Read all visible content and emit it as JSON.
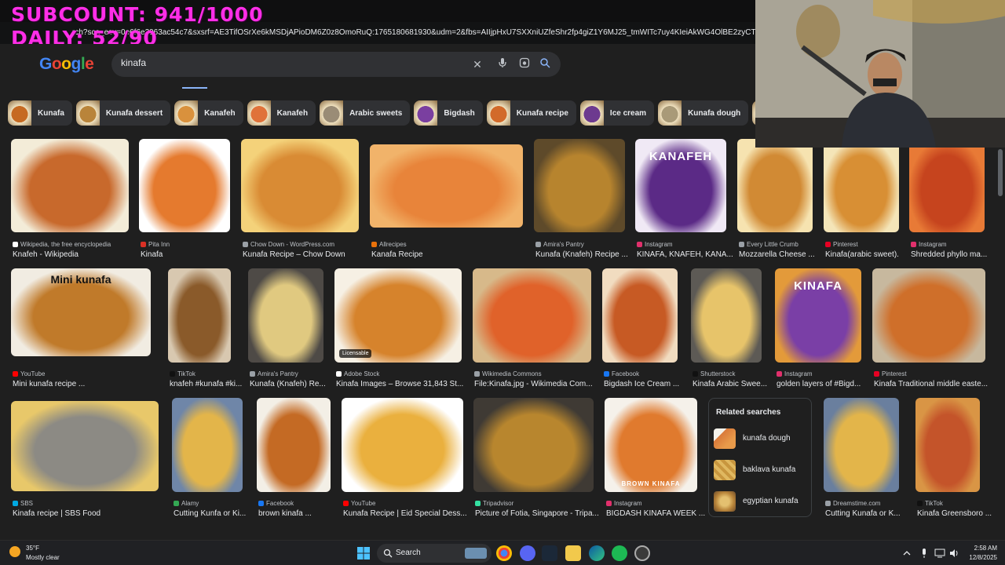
{
  "overlay": {
    "subcount": "SUBCOUNT: 941/1000",
    "daily": "DAILY: 52/90"
  },
  "browser": {
    "url": "rch?sca_esv=0e6f6e2963ac54c7&sxsrf=AE3TifOSrXe6kMSDjAPioDM6Z0z8OmoRuQ:1765180681930&udm=2&fbs=AIIjpHxU7SXXniUZfeShr2fp4giZ1Y6MJ25_tmWITc7uy4KIeiAkWG4OlBE2zyCTM"
  },
  "google": {
    "logo": [
      "G",
      "o",
      "o",
      "g",
      "l",
      "e"
    ],
    "search_value": "kinafa"
  },
  "chips": [
    {
      "label": "Kunafa",
      "color": "#c66a22"
    },
    {
      "label": "Kunafa dessert",
      "color": "#b9843a"
    },
    {
      "label": "Kanafeh",
      "color": "#d9913d"
    },
    {
      "label": "Kanafeh",
      "color": "#e0723a"
    },
    {
      "label": "Arabic sweets",
      "color": "#9a8c76"
    },
    {
      "label": "Bigdash",
      "color": "#7a3fa0"
    },
    {
      "label": "Kunafa recipe",
      "color": "#d26a2a"
    },
    {
      "label": "Ice cream",
      "color": "#6d3a8f"
    },
    {
      "label": "Kunafa dough",
      "color": "#a99a78"
    },
    {
      "label": "",
      "color": "#cc6b2c"
    }
  ],
  "results": [
    {
      "source": "Wikipedia, the free encyclopedia",
      "title": "Knafeh - Wikipedia",
      "fav": "#ffffff",
      "c1": "#c8692c",
      "c2": "#f3ecd8"
    },
    {
      "source": "Pita Inn",
      "title": "Kinafa",
      "fav": "#d93025",
      "c1": "#e57a2e",
      "c2": "#ffffff"
    },
    {
      "source": "Chow Down - WordPress.com",
      "title": "Kunafa Recipe – Chow Down",
      "fav": "#9aa0a6",
      "c1": "#d98b34",
      "c2": "#f4d27a"
    },
    {
      "source": "Allrecipes",
      "title": "Kanafa Recipe",
      "fav": "#e8710a",
      "c1": "#e8843a",
      "c2": "#f1b36a"
    },
    {
      "source": "Amira's Pantry",
      "title": "Kunafa (Knafeh) Recipe ...",
      "fav": "#9aa0a6",
      "c1": "#b7842e",
      "c2": "#5e4a2a"
    },
    {
      "source": "Instagram",
      "title": "KINAFA, KNAFEH, KANA...",
      "fav": "#e1306c",
      "c1": "#5b2a86",
      "c2": "#f0e9f5",
      "label": "KANAFEH"
    },
    {
      "source": "Every Little Crumb",
      "title": "Mozzarella Cheese ...",
      "fav": "#9aa0a6",
      "c1": "#d18a34",
      "c2": "#f6e3b0"
    },
    {
      "source": "Pinterest",
      "title": "Kinafa(arabic sweet).",
      "fav": "#e60023",
      "c1": "#d88f34",
      "c2": "#f4e5b8"
    },
    {
      "source": "Instagram",
      "title": "Shredded phyllo ma...",
      "fav": "#e1306c",
      "c1": "#c6441e",
      "c2": "#e87a36"
    },
    {
      "source": "YouTube",
      "title": "Mini kunafa recipe ...",
      "fav": "#ff0000",
      "c1": "#c07a2a",
      "c2": "#f1ece2",
      "label": "Mini kunafa"
    },
    {
      "source": "TikTok",
      "title": "knafeh #kunafa #ki...",
      "fav": "#111111",
      "c1": "#8a5a2a",
      "c2": "#d8c8b0"
    },
    {
      "source": "Amira's Pantry",
      "title": "Kunafa (Knafeh) Re...",
      "fav": "#9aa0a6",
      "c1": "#e0c980",
      "c2": "#4e4a46"
    },
    {
      "source": "Adobe Stock",
      "title": "Kinafa Images – Browse 31,843 St...",
      "fav": "#ffffff",
      "c1": "#d6832c",
      "c2": "#f6f0e4",
      "badge": "Licensable"
    },
    {
      "source": "Wikimedia Commons",
      "title": "File:Kinafa.jpg - Wikimedia Com...",
      "fav": "#9aa0a6",
      "c1": "#e0622a",
      "c2": "#d7b98a"
    },
    {
      "source": "Facebook",
      "title": "Bigdash Ice Cream ...",
      "fav": "#1877f2",
      "c1": "#c75a24",
      "c2": "#f1dcc0"
    },
    {
      "source": "Shutterstock",
      "title": "Kinafa Arabic Swee...",
      "fav": "#111111",
      "c1": "#e7c46a",
      "c2": "#5d5a55"
    },
    {
      "source": "Instagram",
      "title": "golden layers of #Bigd...",
      "fav": "#e1306c",
      "c1": "#7a3fa6",
      "c2": "#e39a3a",
      "label": "KINAFA"
    },
    {
      "source": "Pinterest",
      "title": "Kinafa Traditional middle easte...",
      "fav": "#e60023",
      "c1": "#cf6f2a",
      "c2": "#c7b89e"
    },
    {
      "source": "SBS",
      "title": "Kinafa recipe | SBS Food",
      "fav": "#00a8e1",
      "c1": "#8c8a84",
      "c2": "#e8c86a"
    },
    {
      "source": "Alamy",
      "title": "Cutting Kunfa or Ki...",
      "fav": "#34a853",
      "c1": "#e3b54a",
      "c2": "#6f86a8"
    },
    {
      "source": "Facebook",
      "title": "brown kinafa ...",
      "fav": "#1877f2",
      "c1": "#c46a24",
      "c2": "#f3efe6"
    },
    {
      "source": "YouTube",
      "title": "Kunafa Recipe | Eid Special Dess...",
      "fav": "#ff0000",
      "c1": "#eab03e",
      "c2": "#ffffff"
    },
    {
      "source": "Tripadvisor",
      "title": "Picture of Fotia, Singapore - Tripa...",
      "fav": "#34e0a1",
      "c1": "#b8862e",
      "c2": "#3f3a34"
    },
    {
      "source": "Instagram",
      "title": "BIGDASH KINAFA WEEK ...",
      "fav": "#e1306c",
      "c1": "#e07a2e",
      "c2": "#f5f1ea",
      "label": "BROWN KINAFA"
    },
    {
      "source": "Dreamstime.com",
      "title": "Cutting Kunafa or K...",
      "fav": "#9aa0a6",
      "c1": "#e3b54a",
      "c2": "#6a7f9e"
    },
    {
      "source": "TikTok",
      "title": "Kinafa Greensboro ...",
      "fav": "#111111",
      "c1": "#c4542a",
      "c2": "#d99545"
    }
  ],
  "related": {
    "title": "Related searches",
    "items": [
      {
        "label": "kunafa dough",
        "color": "#d97a3a"
      },
      {
        "label": "baklava kunafa",
        "color": "#c8963e"
      },
      {
        "label": "egyptian kunafa",
        "color": "#b8843a"
      }
    ]
  },
  "taskbar": {
    "temp": "35°F",
    "weather": "Mostly clear",
    "search": "Search",
    "time": "2:58 AM",
    "date": "12/8/2025"
  }
}
